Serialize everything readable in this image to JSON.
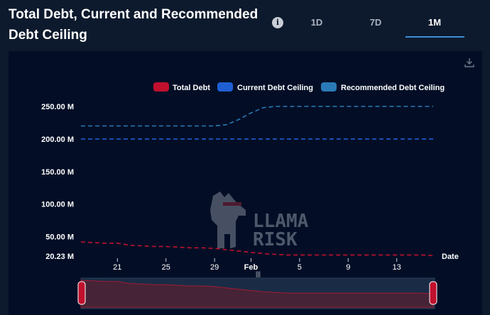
{
  "header": {
    "title": "Total Debt, Current and Recommended Debt Ceiling",
    "info_icon": "info-icon",
    "tabs": [
      {
        "label": "1D",
        "active": false
      },
      {
        "label": "7D",
        "active": false
      },
      {
        "label": "1M",
        "active": true
      }
    ],
    "download_icon": "download-icon"
  },
  "watermark": {
    "text_line1": "LLAMA",
    "text_line2": "RISK"
  },
  "colors": {
    "background": "#0d1a2d",
    "plot_background": "#030e26",
    "total_debt": "#c0102e",
    "current_ceiling": "#1f5fd4",
    "recommended_ceiling": "#2a7ab8",
    "tab_accent": "#3a8fd9"
  },
  "chart_data": {
    "type": "line",
    "title": "Total Debt, Current and Recommended Debt Ceiling",
    "xlabel": "Date",
    "ylabel": "",
    "ylim": [
      20.23,
      270
    ],
    "y_ticks": [
      20.23,
      50,
      100,
      150,
      200,
      250
    ],
    "y_tick_labels": [
      "20.23 M",
      "50.00 M",
      "100.00 M",
      "150.00 M",
      "200.00 M",
      "250.00 M"
    ],
    "x_range": [
      "2024-01-18",
      "2024-02-16"
    ],
    "x_ticks": [
      "2024-01-21",
      "2024-01-25",
      "2024-01-29",
      "2024-02-01",
      "2024-02-05",
      "2024-02-09",
      "2024-02-13"
    ],
    "x_tick_labels": [
      "21",
      "25",
      "29",
      "Feb",
      "5",
      "9",
      "13"
    ],
    "legend_position": "top-right",
    "grid": false,
    "line_style": "dashed",
    "series": [
      {
        "name": "Total Debt",
        "color": "#c0102e",
        "points": [
          [
            "2024-01-18",
            42
          ],
          [
            "2024-01-19",
            41
          ],
          [
            "2024-01-20",
            40
          ],
          [
            "2024-01-21",
            40
          ],
          [
            "2024-01-22",
            37
          ],
          [
            "2024-01-23",
            36
          ],
          [
            "2024-01-24",
            35
          ],
          [
            "2024-01-25",
            35
          ],
          [
            "2024-01-26",
            34
          ],
          [
            "2024-01-27",
            33
          ],
          [
            "2024-01-28",
            33
          ],
          [
            "2024-01-29",
            32
          ],
          [
            "2024-01-30",
            30
          ],
          [
            "2024-01-31",
            28
          ],
          [
            "2024-02-01",
            26
          ],
          [
            "2024-02-02",
            24
          ],
          [
            "2024-02-03",
            23
          ],
          [
            "2024-02-04",
            22
          ],
          [
            "2024-02-05",
            22
          ],
          [
            "2024-02-06",
            22
          ],
          [
            "2024-02-07",
            22
          ],
          [
            "2024-02-08",
            22
          ],
          [
            "2024-02-09",
            22
          ],
          [
            "2024-02-10",
            22
          ],
          [
            "2024-02-11",
            22
          ],
          [
            "2024-02-12",
            22
          ],
          [
            "2024-02-13",
            22
          ],
          [
            "2024-02-14",
            22
          ],
          [
            "2024-02-15",
            22
          ],
          [
            "2024-02-16",
            21
          ]
        ]
      },
      {
        "name": "Current Debt Ceiling",
        "color": "#1f5fd4",
        "points": [
          [
            "2024-01-18",
            200
          ],
          [
            "2024-02-16",
            200
          ]
        ]
      },
      {
        "name": "Recommended Debt Ceiling",
        "color": "#2a7ab8",
        "points": [
          [
            "2024-01-18",
            220
          ],
          [
            "2024-01-29",
            220
          ],
          [
            "2024-01-30",
            222
          ],
          [
            "2024-01-31",
            230
          ],
          [
            "2024-02-01",
            240
          ],
          [
            "2024-02-02",
            248
          ],
          [
            "2024-02-03",
            250
          ],
          [
            "2024-02-16",
            250
          ]
        ]
      }
    ],
    "navigator": {
      "series": "Total Debt",
      "handles": 2
    }
  }
}
